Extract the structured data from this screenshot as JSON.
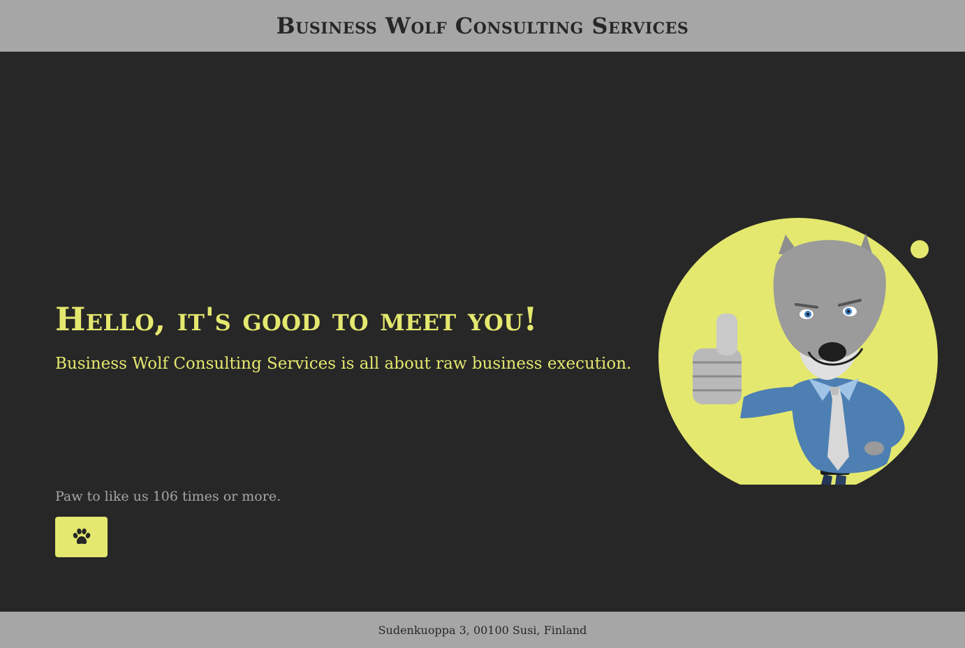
{
  "header": {
    "title": "Business Wolf Consulting Services"
  },
  "hero": {
    "heading": "Hello, it's good to meet you!",
    "subheading": "Business Wolf Consulting Services is all about raw business execution."
  },
  "like": {
    "text": "Paw to like us 106 times or more.",
    "count": 106,
    "button_icon": "paw-icon"
  },
  "illustration": {
    "icon": "wolf-mascot-thumbs-up"
  },
  "footer": {
    "address": "Sudenkuoppa 3, 00100 Susi, Finland"
  },
  "colors": {
    "background": "#272727",
    "header_footer": "#a6a6a6",
    "accent": "#e4e86e",
    "muted_text": "#a6a6a6"
  }
}
